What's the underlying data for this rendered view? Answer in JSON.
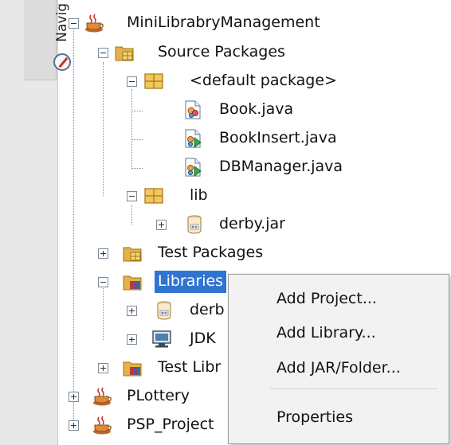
{
  "navigator_tab": {
    "label": "Navig",
    "icon": "compass-icon"
  },
  "tree": {
    "project": {
      "label": "MiniLibrabryManagement",
      "icon": "coffee-cup-icon"
    },
    "source_packages": {
      "label": "Source Packages",
      "icon": "folder-package-icon"
    },
    "default_package": {
      "label": "<default package>",
      "icon": "package-icon"
    },
    "files": [
      {
        "label": "Book.java",
        "icon": "java-class-icon"
      },
      {
        "label": "BookInsert.java",
        "icon": "java-main-class-icon"
      },
      {
        "label": "DBManager.java",
        "icon": "java-main-class-icon"
      }
    ],
    "lib_package": {
      "label": "lib",
      "icon": "package-icon"
    },
    "derby_jar": {
      "label": "derby.jar",
      "icon": "jar-icon"
    },
    "test_packages": {
      "label": "Test Packages",
      "icon": "folder-package-icon"
    },
    "libraries": {
      "label": "Libraries",
      "icon": "library-folder-icon"
    },
    "libraries_children": [
      {
        "label": "derb",
        "icon": "jar-icon"
      },
      {
        "label": "JDK",
        "icon": "jdk-monitor-icon"
      }
    ],
    "test_libraries": {
      "label": "Test Libr",
      "icon": "library-folder-icon"
    },
    "other_projects": [
      {
        "label": "PLottery",
        "icon": "coffee-cup-icon"
      },
      {
        "label": "PSP_Project",
        "icon": "coffee-cup-icon"
      }
    ]
  },
  "context_menu": {
    "items": [
      "Add Project...",
      "Add Library...",
      "Add JAR/Folder..."
    ],
    "properties": "Properties"
  },
  "colors": {
    "selection": "#2f74d0",
    "menu_bg": "#f2f2f2"
  }
}
